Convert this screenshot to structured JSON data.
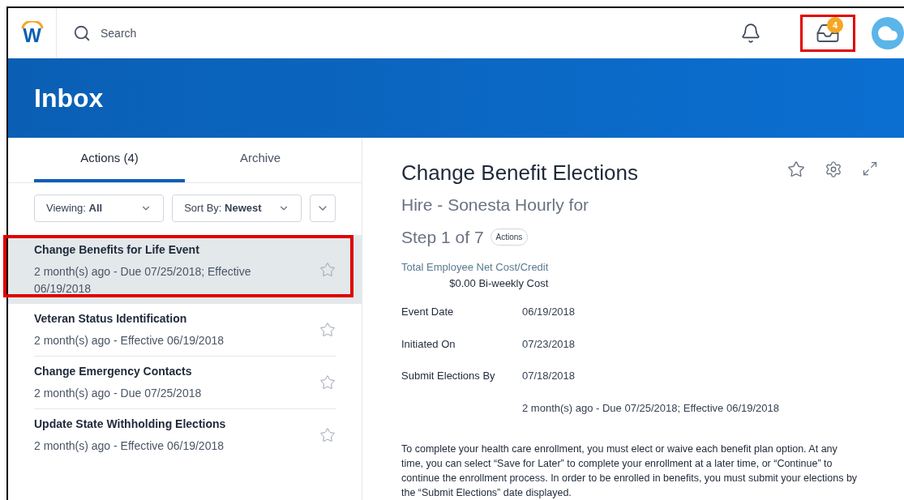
{
  "header": {
    "logo": "W",
    "search": {
      "placeholder": "Search"
    },
    "inbox_badge": "4",
    "inbox_annotated": true
  },
  "banner": {
    "title": "Inbox"
  },
  "tabs": [
    {
      "label": "Actions (4)",
      "selected": true
    },
    {
      "label": "Archive",
      "selected": false
    }
  ],
  "filters": [
    {
      "label": "Viewing:",
      "value": "All"
    },
    {
      "label": "Sort By:",
      "value": "Newest"
    }
  ],
  "items": [
    {
      "title": "Change Benefits for Life Event",
      "meta": "2 month(s) ago - Due 07/25/2018; Effective 06/19/2018",
      "selected": true,
      "annotated": true
    },
    {
      "title": "Veteran Status Identification",
      "meta": "2 month(s) ago - Effective 06/19/2018",
      "selected": false,
      "annotated": false
    },
    {
      "title": "Change Emergency Contacts",
      "meta": "2 month(s) ago - Due 07/25/2018",
      "selected": false,
      "annotated": false
    },
    {
      "title": "Update State Withholding Elections",
      "meta": "2 month(s) ago - Effective 06/19/2018",
      "selected": false,
      "annotated": false
    }
  ],
  "detail": {
    "title": "Change Benefit Elections",
    "subtitle": "Hire - Sonesta Hourly for",
    "step": "Step 1 of 7",
    "actions_button": "Actions",
    "cost_label": "Total Employee Net Cost/Credit",
    "cost_value": "$0.00 Bi-weekly Cost",
    "fields": [
      {
        "label": "Event Date",
        "value": "06/19/2018"
      },
      {
        "label": "Initiated On",
        "value": "07/23/2018"
      },
      {
        "label": "Submit Elections By",
        "value": "07/18/2018"
      },
      {
        "value": "2 month(s) ago - Due 07/25/2018; Effective 06/19/2018"
      }
    ],
    "instructions": "To complete your health care enrollment, you must elect or waive each benefit plan option.  At any time, you can select “Save for Later” to complete your enrollment at a later time, or “Continue” to continue the enrollment process.  In order to be enrolled in benefits, you must submit your elections by the “Submit Elections” date displayed."
  }
}
